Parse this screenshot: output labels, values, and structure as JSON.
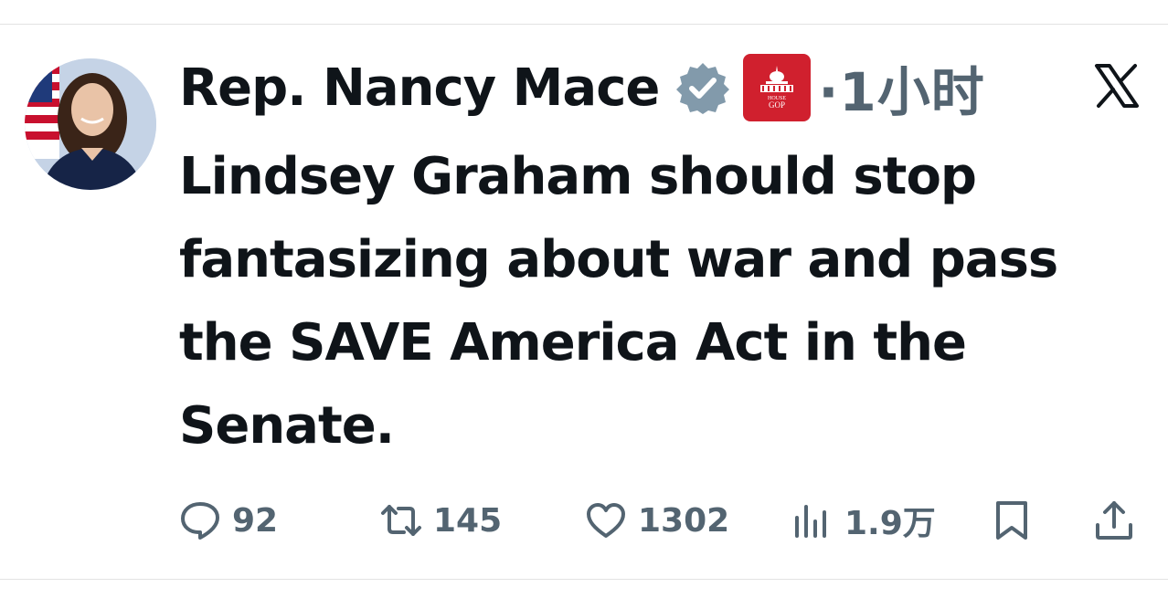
{
  "tweet": {
    "author_name": "Rep. Nancy Mace",
    "affiliation_badge_text_top": "HOUSE",
    "affiliation_badge_text_bottom": "GOP",
    "timestamp": "·1小时",
    "text": "Lindsey Graham should stop fantasizing about war and pass the SAVE America Act in the Senate."
  },
  "actions": {
    "replies": "92",
    "reposts": "145",
    "likes": "1302",
    "views": "1.9万"
  },
  "colors": {
    "text_primary": "#0f1419",
    "text_secondary": "#536471",
    "verified_badge": "#829aab",
    "affiliation_badge": "#d0202e"
  },
  "icons": [
    "verified-icon",
    "house-gop-badge-icon",
    "x-logo-icon",
    "reply-icon",
    "repost-icon",
    "like-icon",
    "views-icon",
    "bookmark-icon",
    "share-icon"
  ]
}
